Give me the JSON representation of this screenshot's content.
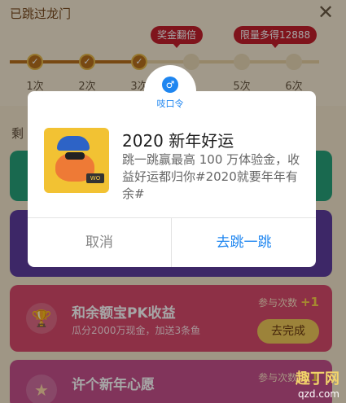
{
  "header": {
    "title": "已跳过龙门",
    "close_icon": "close-icon",
    "badges": [
      "奖金翻倍",
      "限量多得12888"
    ],
    "steps": [
      {
        "label": "1次",
        "done": true
      },
      {
        "label": "2次",
        "done": true
      },
      {
        "label": "3次",
        "done": true
      },
      {
        "label": "",
        "done": false
      },
      {
        "label": "5次",
        "done": false
      },
      {
        "label": "6次",
        "done": false
      }
    ]
  },
  "remain_label": "剩",
  "cards": [
    {
      "title": "",
      "subtitle": "",
      "count_label": "",
      "plus": "",
      "button": ""
    },
    {
      "title": "",
      "subtitle": "",
      "count_label": "",
      "plus": "",
      "button": ""
    },
    {
      "title": "和余额宝PK收益",
      "subtitle": "瓜分2000万现金，加送3条鱼",
      "count_label": "参与次数",
      "plus": "+1",
      "button": "去完成",
      "icon": "trophy-icon"
    },
    {
      "title": "许个新年心愿",
      "subtitle": "",
      "count_label": "参与次数",
      "plus": "+1",
      "button": "去完成",
      "icon": "wish-icon"
    }
  ],
  "dialog": {
    "badge_label": "吱口令",
    "badge_icon": "alipay-password-icon",
    "title": "2020 新年好运",
    "text": "跳一跳赢最高 100 万体验金，收益好运都归你#2020就要年年有余#",
    "cancel_label": "取消",
    "confirm_label": "去跳一跳",
    "image_tag": "WO"
  },
  "watermark": {
    "text": "趣丁网",
    "url": "qzd.com"
  },
  "colors": {
    "accent_blue": "#1f86f0",
    "badge_red": "#c4202c",
    "progress_brown": "#b9701e"
  }
}
